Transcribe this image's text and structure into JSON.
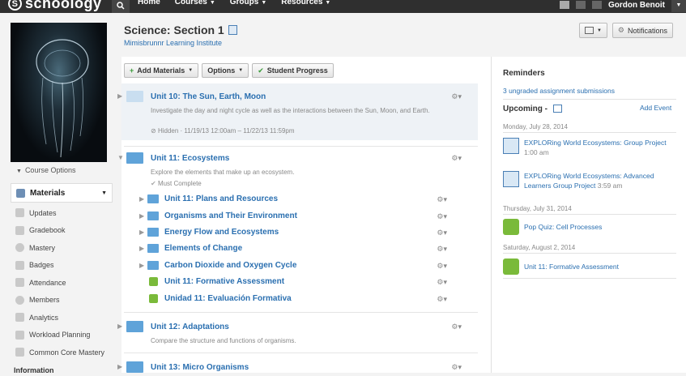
{
  "topbar": {
    "logo": "schoology",
    "nav": [
      "Home",
      "Courses",
      "Groups",
      "Resources"
    ],
    "user": "Gordon Benoit"
  },
  "sidebar": {
    "course_options": "Course Options",
    "active_item": "Materials",
    "items": [
      "Updates",
      "Gradebook",
      "Mastery",
      "Badges",
      "Attendance",
      "Members",
      "Analytics",
      "Workload Planning",
      "Common Core Mastery"
    ],
    "section_heading": "Information"
  },
  "header": {
    "title": "Science: Section 1",
    "school": "Mimisbrunnr Learning Institute",
    "notifications_label": "Notifications"
  },
  "toolbar": {
    "add_materials": "Add Materials",
    "options": "Options",
    "student_progress": "Student Progress"
  },
  "units": [
    {
      "title": "Unit 10: The Sun, Earth, Moon",
      "description": "Investigate the day and night cycle as well as the interactions between the Sun, Moon, and Earth.",
      "status": "Hidden",
      "dates": "11/19/13 12:00am – 11/22/13 11:59pm"
    },
    {
      "title": "Unit 11: Ecosystems",
      "description": "Explore the elements that make up an ecosystem.",
      "requirement": "Must Complete",
      "children": [
        "Unit 11: Plans and Resources",
        "Organisms and Their Environment",
        "Energy Flow and Ecosystems",
        "Elements of Change",
        "Carbon Dioxide and Oxygen Cycle",
        "Unit 11: Formative Assessment",
        "Unidad 11: Evaluación Formativa"
      ]
    },
    {
      "title": "Unit 12: Adaptations",
      "description": "Compare the structure and functions of organisms."
    },
    {
      "title": "Unit 13: Micro Organisms"
    }
  ],
  "reminders": {
    "heading": "Reminders",
    "link": "3 ungraded assignment submissions"
  },
  "upcoming": {
    "heading": "Upcoming -",
    "add_event": "Add Event",
    "groups": [
      {
        "date": "Monday, July 28, 2014",
        "events": [
          {
            "title": "EXPLORing World Ecosystems: Group Project",
            "time": "1:00 am",
            "icon": "assignment-icon"
          },
          {
            "title": "EXPLORing World Ecosystems: Advanced Learners Group Project",
            "time": "3:59 am",
            "icon": "assignment-icon"
          }
        ]
      },
      {
        "date": "Thursday, July 31, 2014",
        "events": [
          {
            "title": "Pop Quiz: Cell Processes",
            "time": "",
            "icon": "assessment-icon"
          }
        ]
      },
      {
        "date": "Saturday, August 2, 2014",
        "events": [
          {
            "title": "Unit 11: Formative Assessment",
            "time": "",
            "icon": "assessment-icon"
          }
        ]
      }
    ]
  }
}
